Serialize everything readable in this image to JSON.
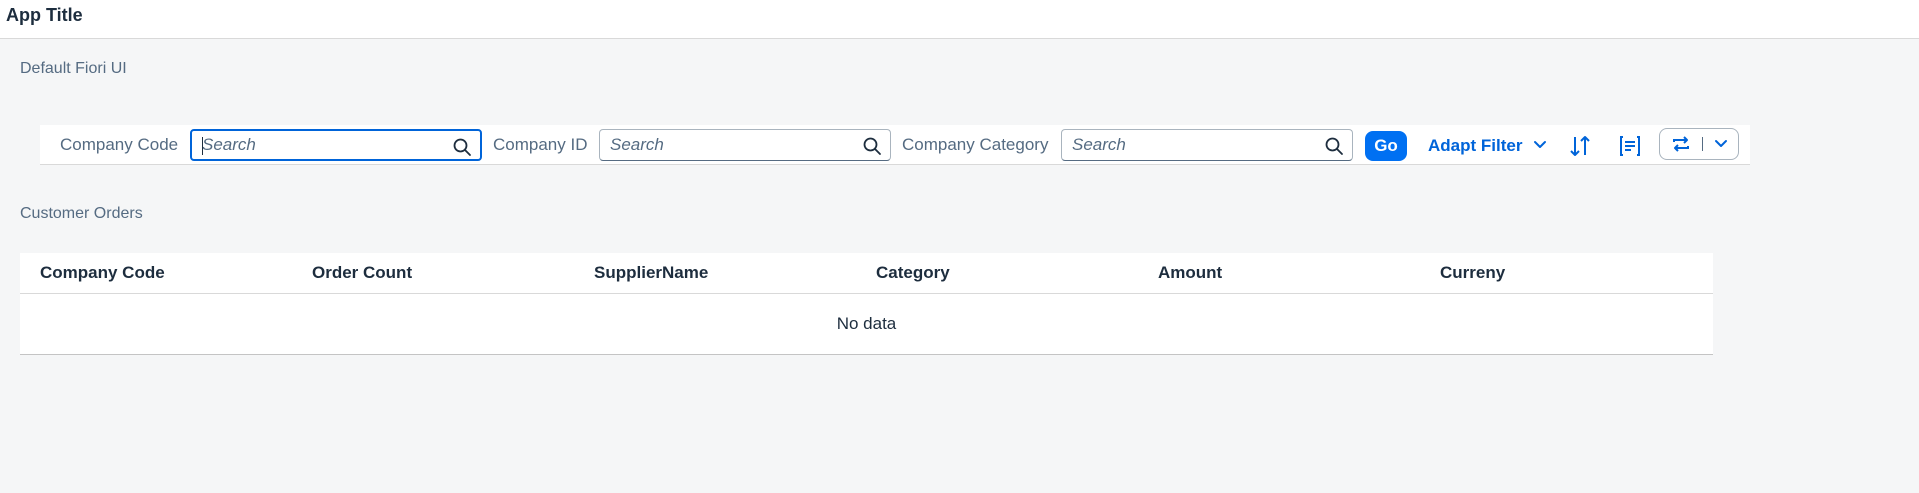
{
  "app": {
    "title": "App Title",
    "subtitle": "Default Fiori UI"
  },
  "filterbar": {
    "fields": [
      {
        "label": "Company Code",
        "placeholder": "Search",
        "focused": true
      },
      {
        "label": "Company ID",
        "placeholder": "Search",
        "focused": false
      },
      {
        "label": "Company Category",
        "placeholder": "Search",
        "focused": false
      }
    ],
    "go_label": "Go",
    "adapt_label": "Adapt Filter"
  },
  "table": {
    "title": "Customer Orders",
    "columns": [
      "Company Code",
      "Order Count",
      "SupplierName",
      "Category",
      "Amount",
      "Curreny"
    ],
    "no_data": "No data"
  },
  "colors": {
    "accent": "#0070f2",
    "link": "#0064d9",
    "background": "#f5f6f7",
    "text": "#1d2d3e",
    "label": "#556b82"
  },
  "icons": [
    "search-icon",
    "chevron-down-icon",
    "sort-icon",
    "table-settings-icon",
    "variant-sync-icon"
  ]
}
